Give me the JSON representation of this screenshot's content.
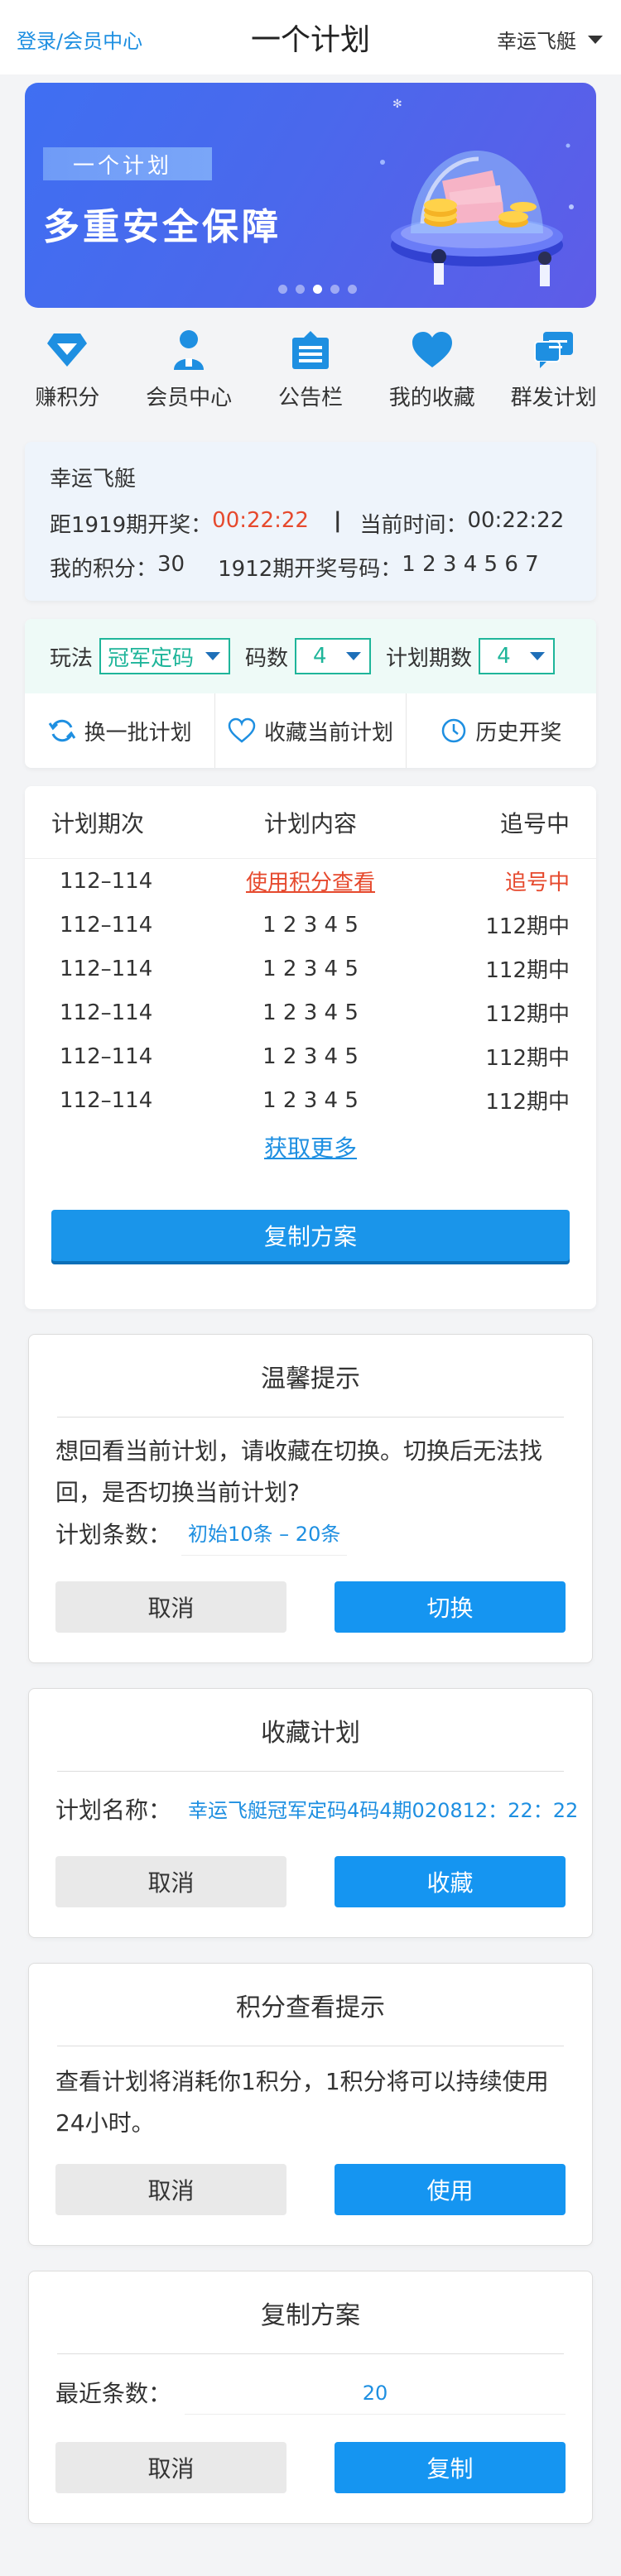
{
  "header": {
    "login_label": "登录/会员中心",
    "title": "一个计划",
    "game_select": "幸运飞艇"
  },
  "banner": {
    "tag": "一个计划",
    "slogan": "多重安全保障",
    "dots_count": 5,
    "active_dot": 3
  },
  "nav": [
    {
      "label": "赚积分",
      "icon": "diamond-icon"
    },
    {
      "label": "会员中心",
      "icon": "user-icon"
    },
    {
      "label": "公告栏",
      "icon": "notice-board-icon"
    },
    {
      "label": "我的收藏",
      "icon": "heart-icon"
    },
    {
      "label": "群发计划",
      "icon": "chat-bubble-icon"
    }
  ],
  "info": {
    "game_name": "幸运飞艇",
    "countdown_label": "距1919期开奖：",
    "countdown_value": "00:22:22",
    "current_time_label": "当前时间：",
    "current_time_value": "00:22:22",
    "points_label": "我的积分：",
    "points_value": "30",
    "last_draw_label": "1912期开奖号码：",
    "last_draw_numbers": "1 2 3 4 5 6 7"
  },
  "controls": {
    "play_label": "玩法",
    "play_value": "冠军定码",
    "code_count_label": "码数",
    "code_count_value": "4",
    "periods_label": "计划期数",
    "periods_value": "4",
    "actions": [
      {
        "label": "换一批计划",
        "icon": "refresh-icon"
      },
      {
        "label": "收藏当前计划",
        "icon": "heart-outline-icon"
      },
      {
        "label": "历史开奖",
        "icon": "clock-icon"
      }
    ]
  },
  "plan_table": {
    "headers": [
      "计划期次",
      "计划内容",
      "追号中"
    ],
    "rows": [
      {
        "period": "112–114",
        "content": "使用积分查看",
        "status": "追号中"
      },
      {
        "period": "112–114",
        "content": "1 2 3 4 5",
        "status": "112期中"
      },
      {
        "period": "112–114",
        "content": "1 2 3 4 5",
        "status": "112期中"
      },
      {
        "period": "112–114",
        "content": "1 2 3 4 5",
        "status": "112期中"
      },
      {
        "period": "112–114",
        "content": "1 2 3 4 5",
        "status": "112期中"
      },
      {
        "period": "112–114",
        "content": "1 2 3 4 5",
        "status": "112期中"
      }
    ],
    "more_label": "获取更多",
    "copy_button": "复制方案"
  },
  "dialog_switch": {
    "title": "温馨提示",
    "message": "想回看当前计划，请收藏在切换。切换后无法找回，是否切换当前计划?",
    "count_label": "计划条数：",
    "count_value": "初始10条 – 20条",
    "cancel": "取消",
    "confirm": "切换"
  },
  "dialog_favorite": {
    "title": "收藏计划",
    "name_label": "计划名称：",
    "name_value": "幸运飞艇冠军定码4码4期020812：22：22",
    "cancel": "取消",
    "confirm": "收藏"
  },
  "dialog_points": {
    "title": "积分查看提示",
    "message": "查看计划将消耗你1积分，1积分将可以持续使用24小时。",
    "cancel": "取消",
    "confirm": "使用"
  },
  "dialog_copy": {
    "title": "复制方案",
    "recent_label": "最近条数：",
    "recent_value": "20",
    "cancel": "取消",
    "confirm": "复制"
  },
  "colors": {
    "primary": "#1a95ea",
    "link": "#1e8fe1",
    "alert_red": "#e6492d",
    "select_green": "#1fb59a",
    "banner_blue": "#4a68ec"
  }
}
